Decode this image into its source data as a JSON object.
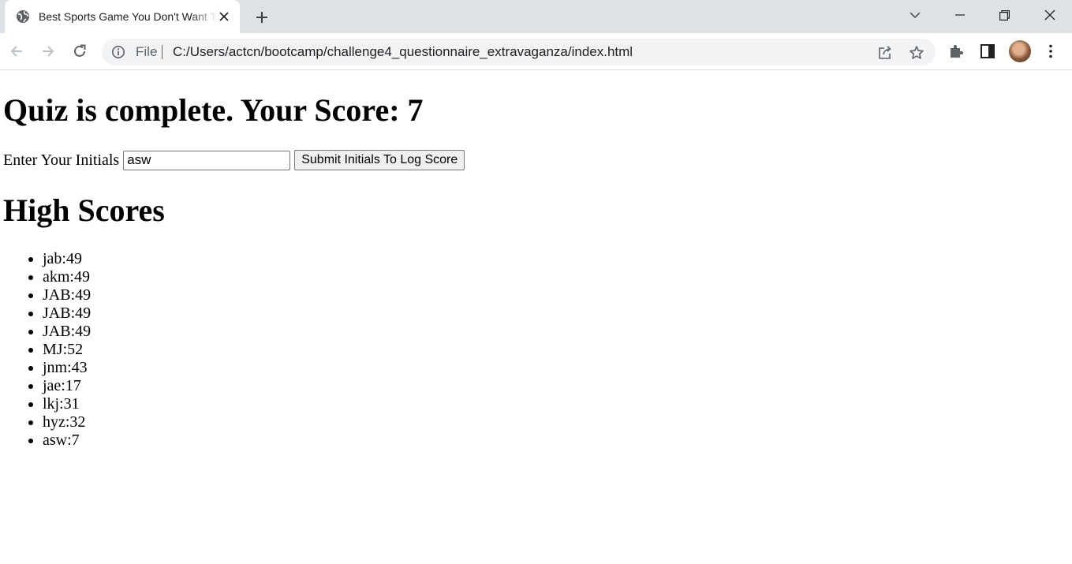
{
  "browser": {
    "tab_title": "Best Sports Game You Don't Want To Play",
    "url_scheme_label": "File",
    "url": "C:/Users/actcn/bootcamp/challenge4_questionnaire_extravaganza/index.html",
    "icons": {
      "favicon": "globe-icon",
      "tab_close": "close-icon",
      "new_tab": "plus-icon",
      "tab_search": "chevron-down-icon",
      "minimize": "minimize-icon",
      "restore": "restore-icon",
      "close_window": "close-icon",
      "back": "arrow-left-icon",
      "forward": "arrow-right-icon",
      "reload": "reload-icon",
      "site_info": "info-icon",
      "share": "share-icon",
      "bookmark": "star-icon",
      "extensions": "puzzle-icon",
      "side_panel": "side-panel-icon",
      "menu": "kebab-menu-icon"
    }
  },
  "page": {
    "score_heading": "Quiz is complete. Your Score: 7",
    "initials_label": "Enter Your Initials",
    "initials_value": "asw",
    "submit_label": "Submit Initials To Log Score",
    "high_scores_heading": "High Scores",
    "high_scores": [
      "jab:49",
      "akm:49",
      "JAB:49",
      "JAB:49",
      "JAB:49",
      "MJ:52",
      "jnm:43",
      "jae:17",
      "lkj:31",
      "hyz:32",
      "asw:7"
    ]
  }
}
